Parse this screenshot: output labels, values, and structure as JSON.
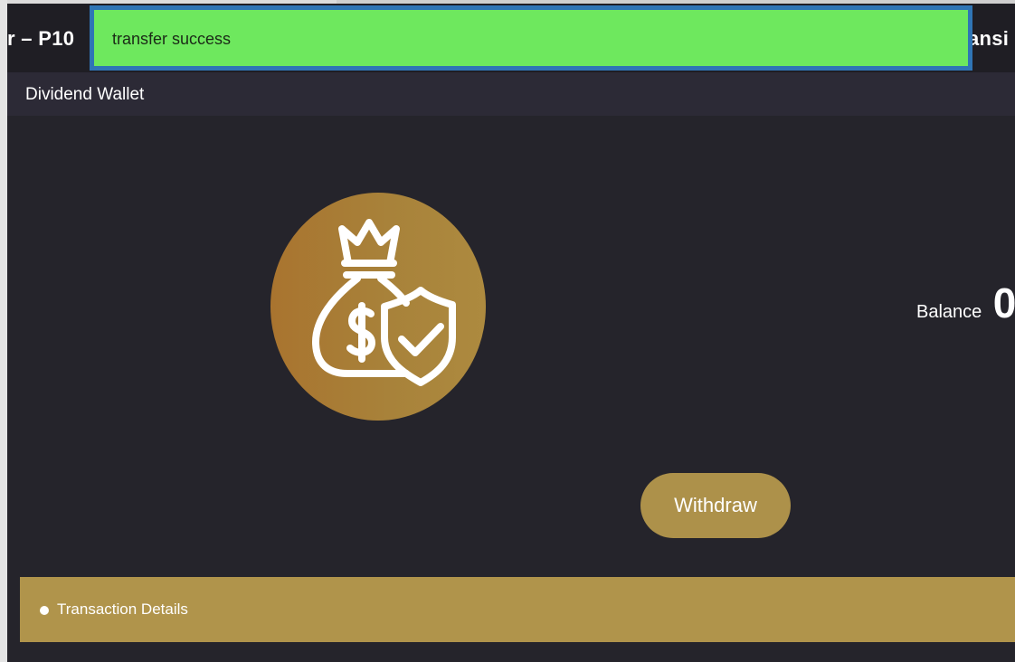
{
  "header": {
    "title_left": "r – P10",
    "title_right": "ansi"
  },
  "toast": {
    "message": "transfer success",
    "color": "#6ee85e",
    "border_color": "#2f75b5"
  },
  "subheader": {
    "title": "Dividend Wallet"
  },
  "wallet": {
    "icon": "money-bag-shield-icon",
    "balance_label": "Balance",
    "balance_value": "0",
    "withdraw_label": "Withdraw"
  },
  "transactions": {
    "label": "Transaction Details"
  },
  "colors": {
    "accent": "#b0944b",
    "background": "#25242b",
    "header": "#1f1e24"
  }
}
